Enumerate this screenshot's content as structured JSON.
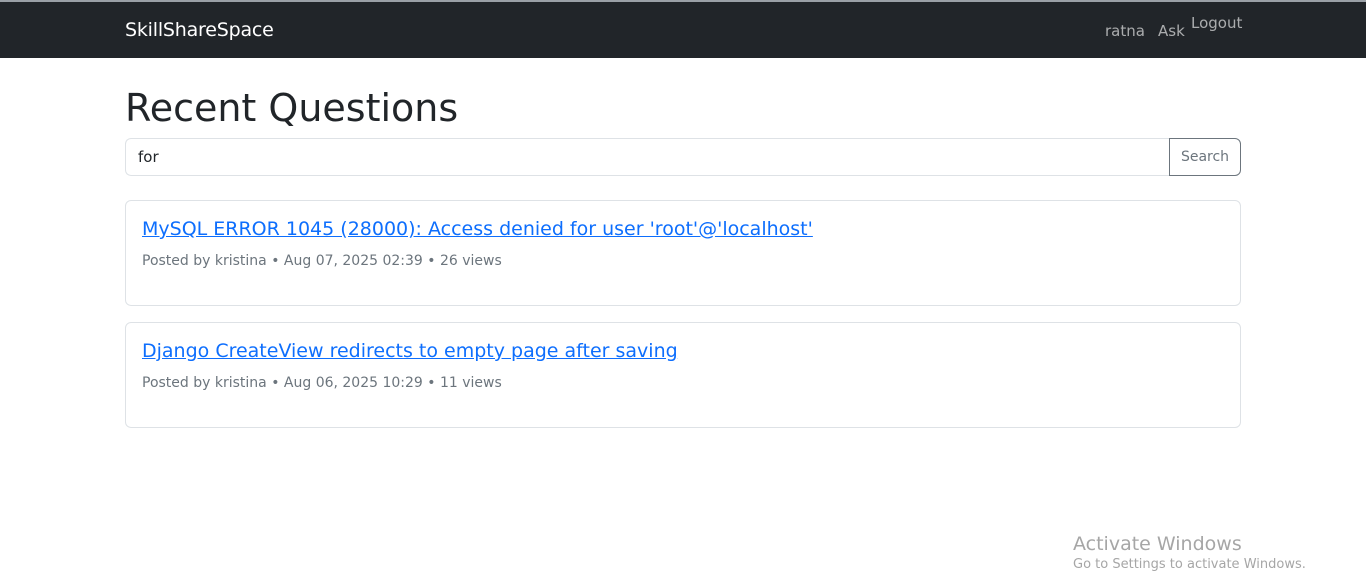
{
  "navbar": {
    "brand": "SkillShareSpace",
    "links": {
      "user": "ratna",
      "ask": "Ask",
      "logout": "Logout"
    }
  },
  "main": {
    "title": "Recent Questions",
    "search": {
      "value": "for",
      "button_label": "Search"
    },
    "questions": [
      {
        "title": "MySQL ERROR 1045 (28000): Access denied for user 'root'@'localhost'",
        "meta": "Posted by kristina • Aug 07, 2025 02:39 • 26 views"
      },
      {
        "title": "Django CreateView redirects to empty page after saving",
        "meta": "Posted by kristina • Aug 06, 2025 10:29 • 11 views"
      }
    ]
  },
  "watermark": {
    "title": "Activate Windows",
    "subtitle": "Go to Settings to activate Windows."
  },
  "colors": {
    "navbar_bg": "#212529",
    "link": "#0d6efd",
    "muted": "#6c757d"
  }
}
